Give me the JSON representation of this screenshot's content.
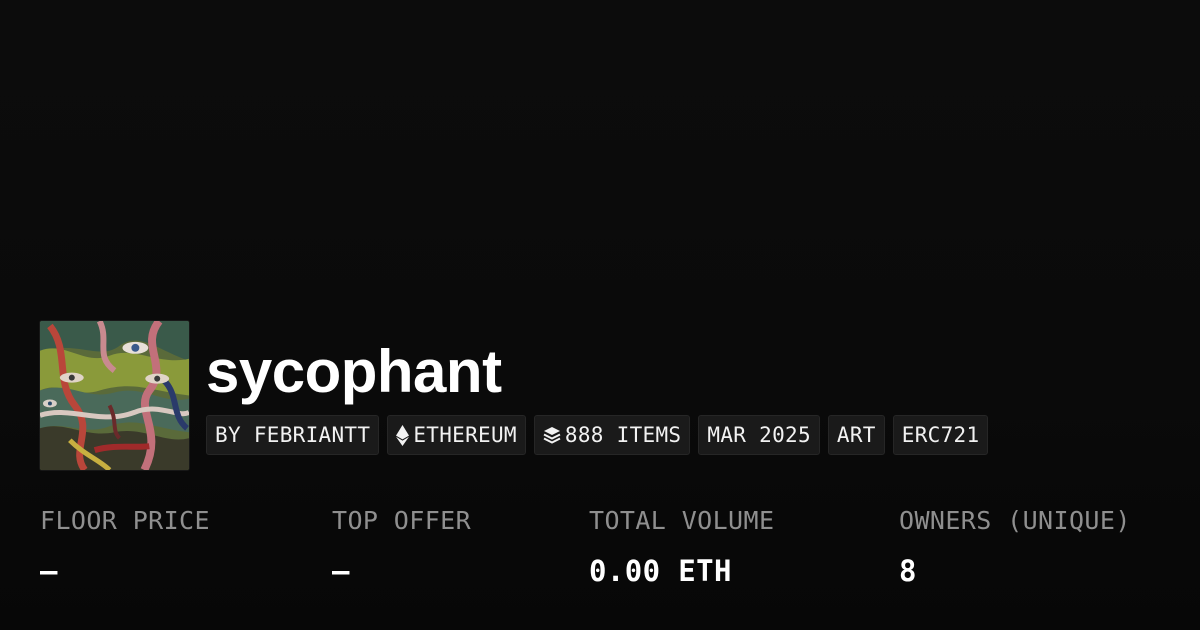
{
  "collection": {
    "name": "sycophant"
  },
  "tags": [
    {
      "label": "BY FEBRIANTT",
      "icon": ""
    },
    {
      "label": "ETHEREUM",
      "icon": "ethereum-icon"
    },
    {
      "label": "888 ITEMS",
      "icon": "layers-icon"
    },
    {
      "label": "MAR 2025",
      "icon": ""
    },
    {
      "label": "ART",
      "icon": ""
    },
    {
      "label": "ERC721",
      "icon": ""
    }
  ],
  "stats": [
    {
      "label": "FLOOR PRICE",
      "value": "–"
    },
    {
      "label": "TOP OFFER",
      "value": "–"
    },
    {
      "label": "TOTAL VOLUME",
      "value": "0.00 ETH"
    },
    {
      "label": "OWNERS (UNIQUE)",
      "value": "8"
    }
  ],
  "colors": {
    "background": "#0b0b0b",
    "text": "#ffffff",
    "muted_label": "#8f8f8f",
    "tag_background": "#1a1a1a"
  }
}
